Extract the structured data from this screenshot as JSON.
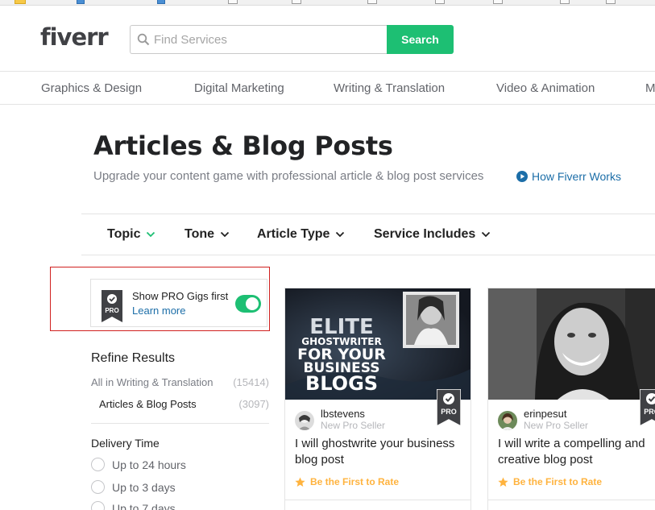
{
  "header": {
    "logo": "fiverr",
    "search_placeholder": "Find Services",
    "search_button": "Search"
  },
  "categories": [
    "Graphics & Design",
    "Digital Marketing",
    "Writing & Translation",
    "Video & Animation",
    "M"
  ],
  "page": {
    "title": "Articles & Blog Posts",
    "subtitle": "Upgrade your content game with professional article & blog post services",
    "how_link": "How Fiverr Works"
  },
  "filters": [
    "Topic",
    "Tone",
    "Article Type",
    "Service Includes"
  ],
  "pro_toggle": {
    "label": "Show PRO Gigs first",
    "learn_more": "Learn more",
    "badge_text": "PRO",
    "enabled": true
  },
  "refine": {
    "title": "Refine Results",
    "parent": {
      "label": "All in Writing & Translation",
      "count": "(15414)"
    },
    "current": {
      "label": "Articles & Blog Posts",
      "count": "(3097)"
    }
  },
  "delivery": {
    "title": "Delivery Time",
    "options": [
      "Up to 24 hours",
      "Up to 3 days",
      "Up to 7 days"
    ]
  },
  "gigs": [
    {
      "seller": "lbstevens",
      "level": "New Pro Seller",
      "title": "I will ghostwrite your business blog post",
      "rating": "Be the First to Rate",
      "image_text": [
        "ELITE",
        "GHOSTWRITER",
        "FOR YOUR",
        "BUSINESS",
        "BLOGS"
      ]
    },
    {
      "seller": "erinpesut",
      "level": "New Pro Seller",
      "title": "I will write a compelling and creative blog post",
      "rating": "Be the First to Rate"
    }
  ],
  "colors": {
    "brand_green": "#1dbf73",
    "link_blue": "#1c6ea8",
    "rating_gold": "#ffb33e",
    "highlight_red": "#d0201f"
  }
}
